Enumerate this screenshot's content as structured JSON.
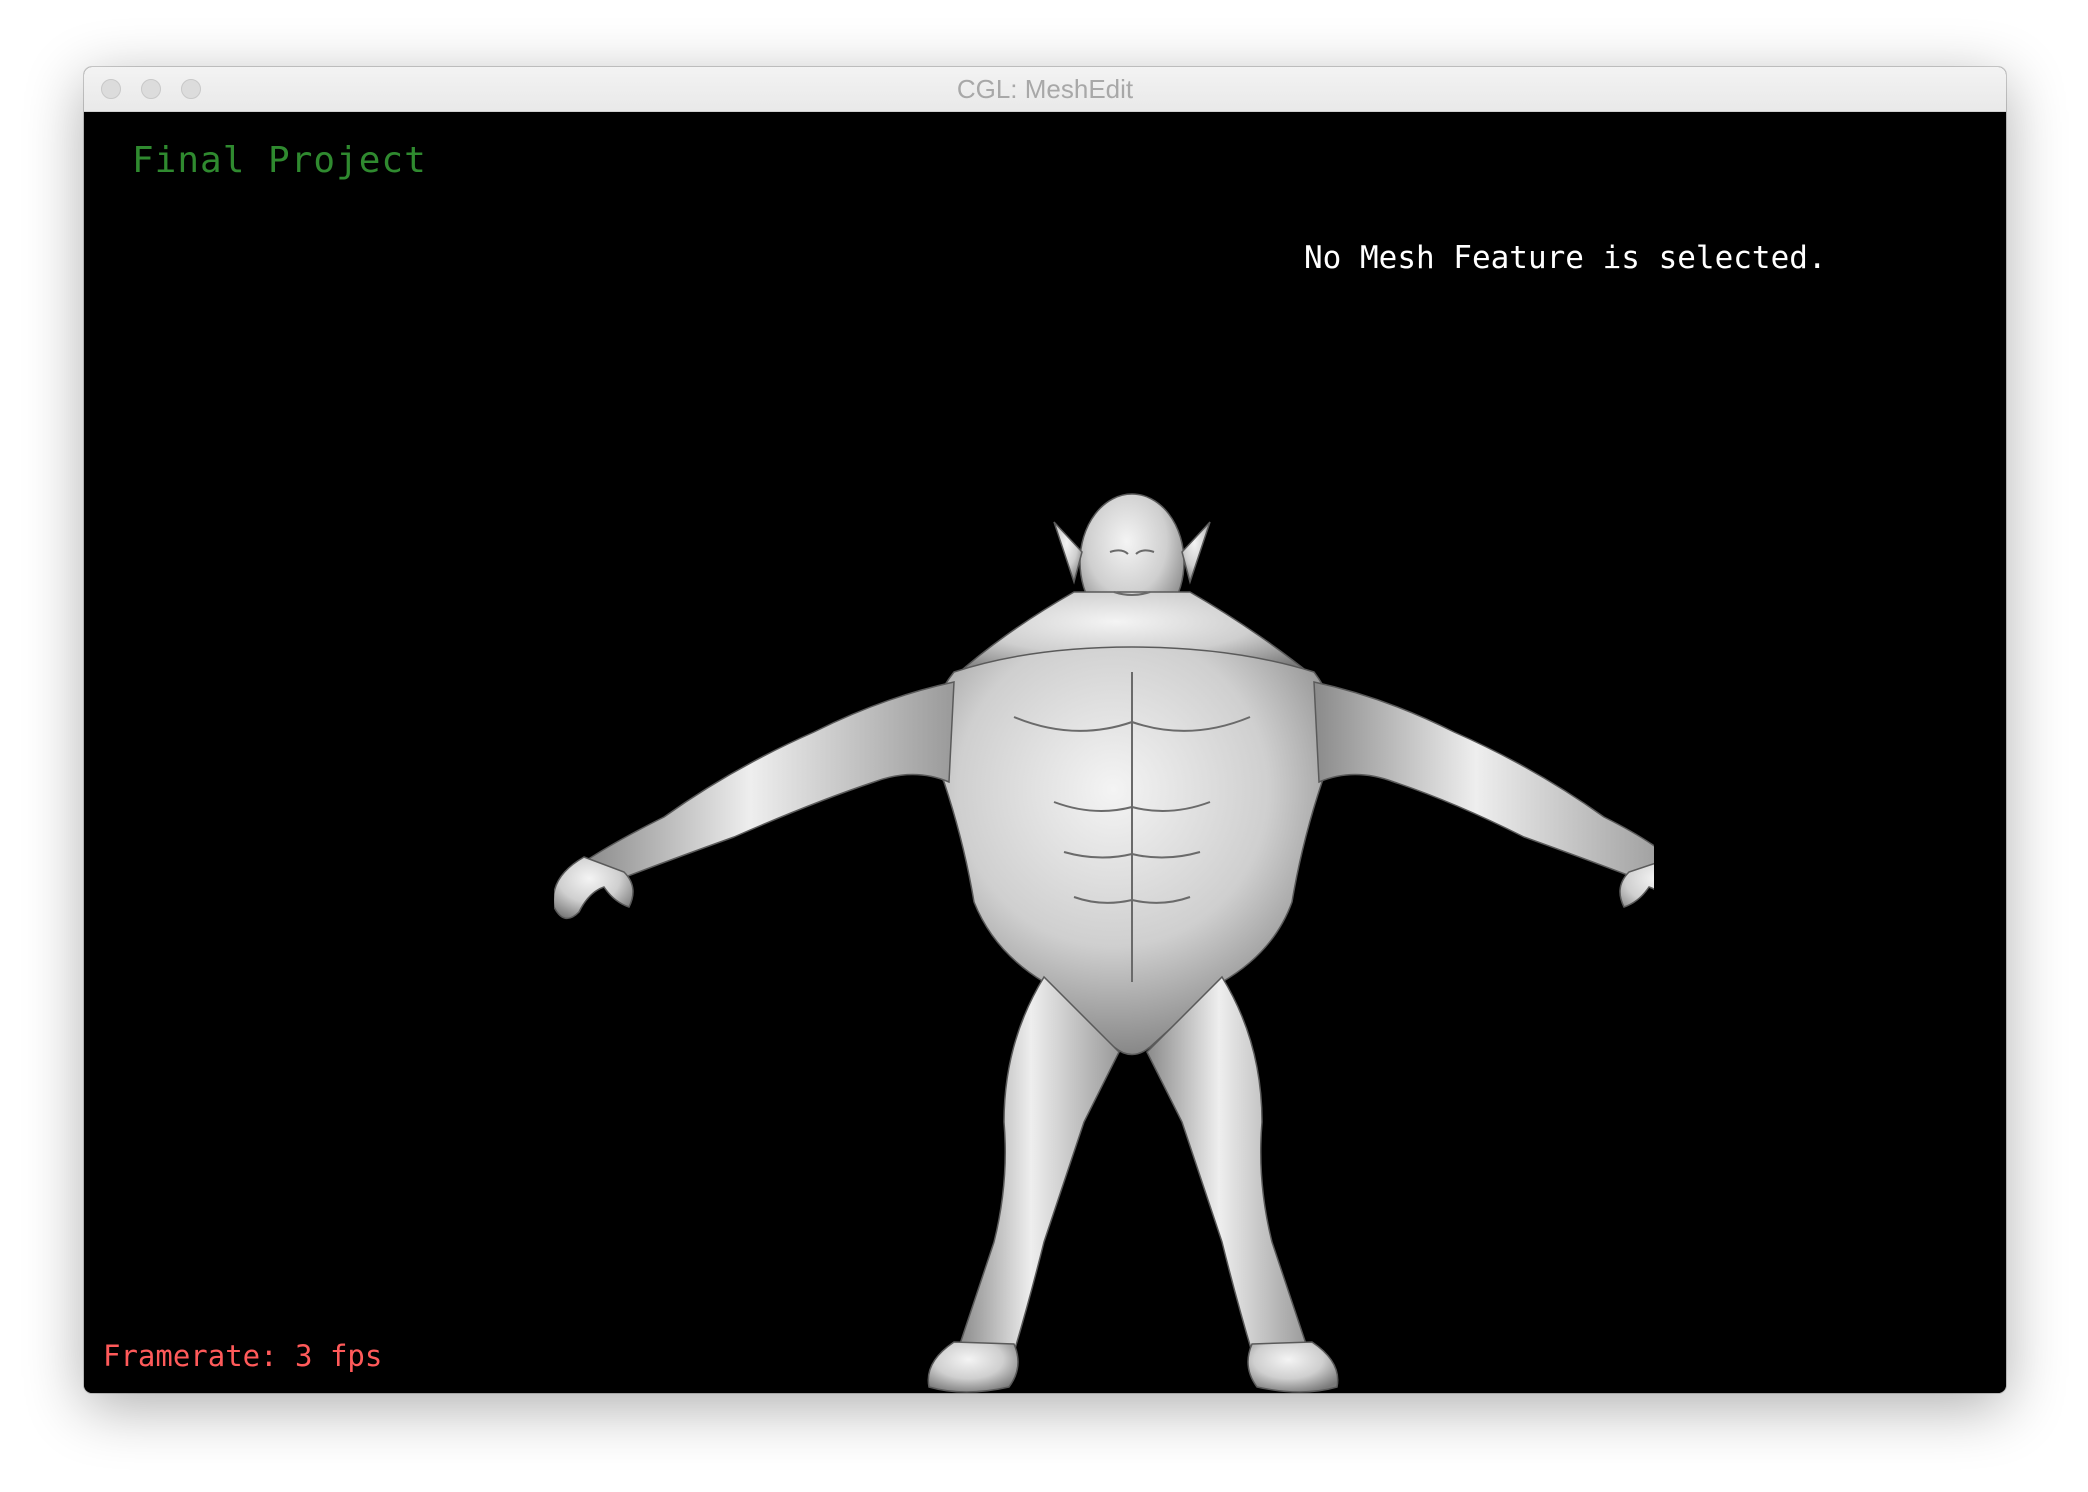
{
  "window": {
    "title": "CGL: MeshEdit"
  },
  "overlay": {
    "project_title": "Final Project",
    "selection_info": "No Mesh Feature is selected.",
    "framerate": "Framerate: 3 fps"
  },
  "colors": {
    "viewport_background": "#000000",
    "project_title": "#2f8a2f",
    "selection_info": "#ffffff",
    "framerate": "#ff5a5a",
    "model_shading": "#d8d8d8"
  },
  "icons": {
    "close": "close-traffic-light-icon",
    "minimize": "minimize-traffic-light-icon",
    "zoom": "zoom-traffic-light-icon"
  }
}
